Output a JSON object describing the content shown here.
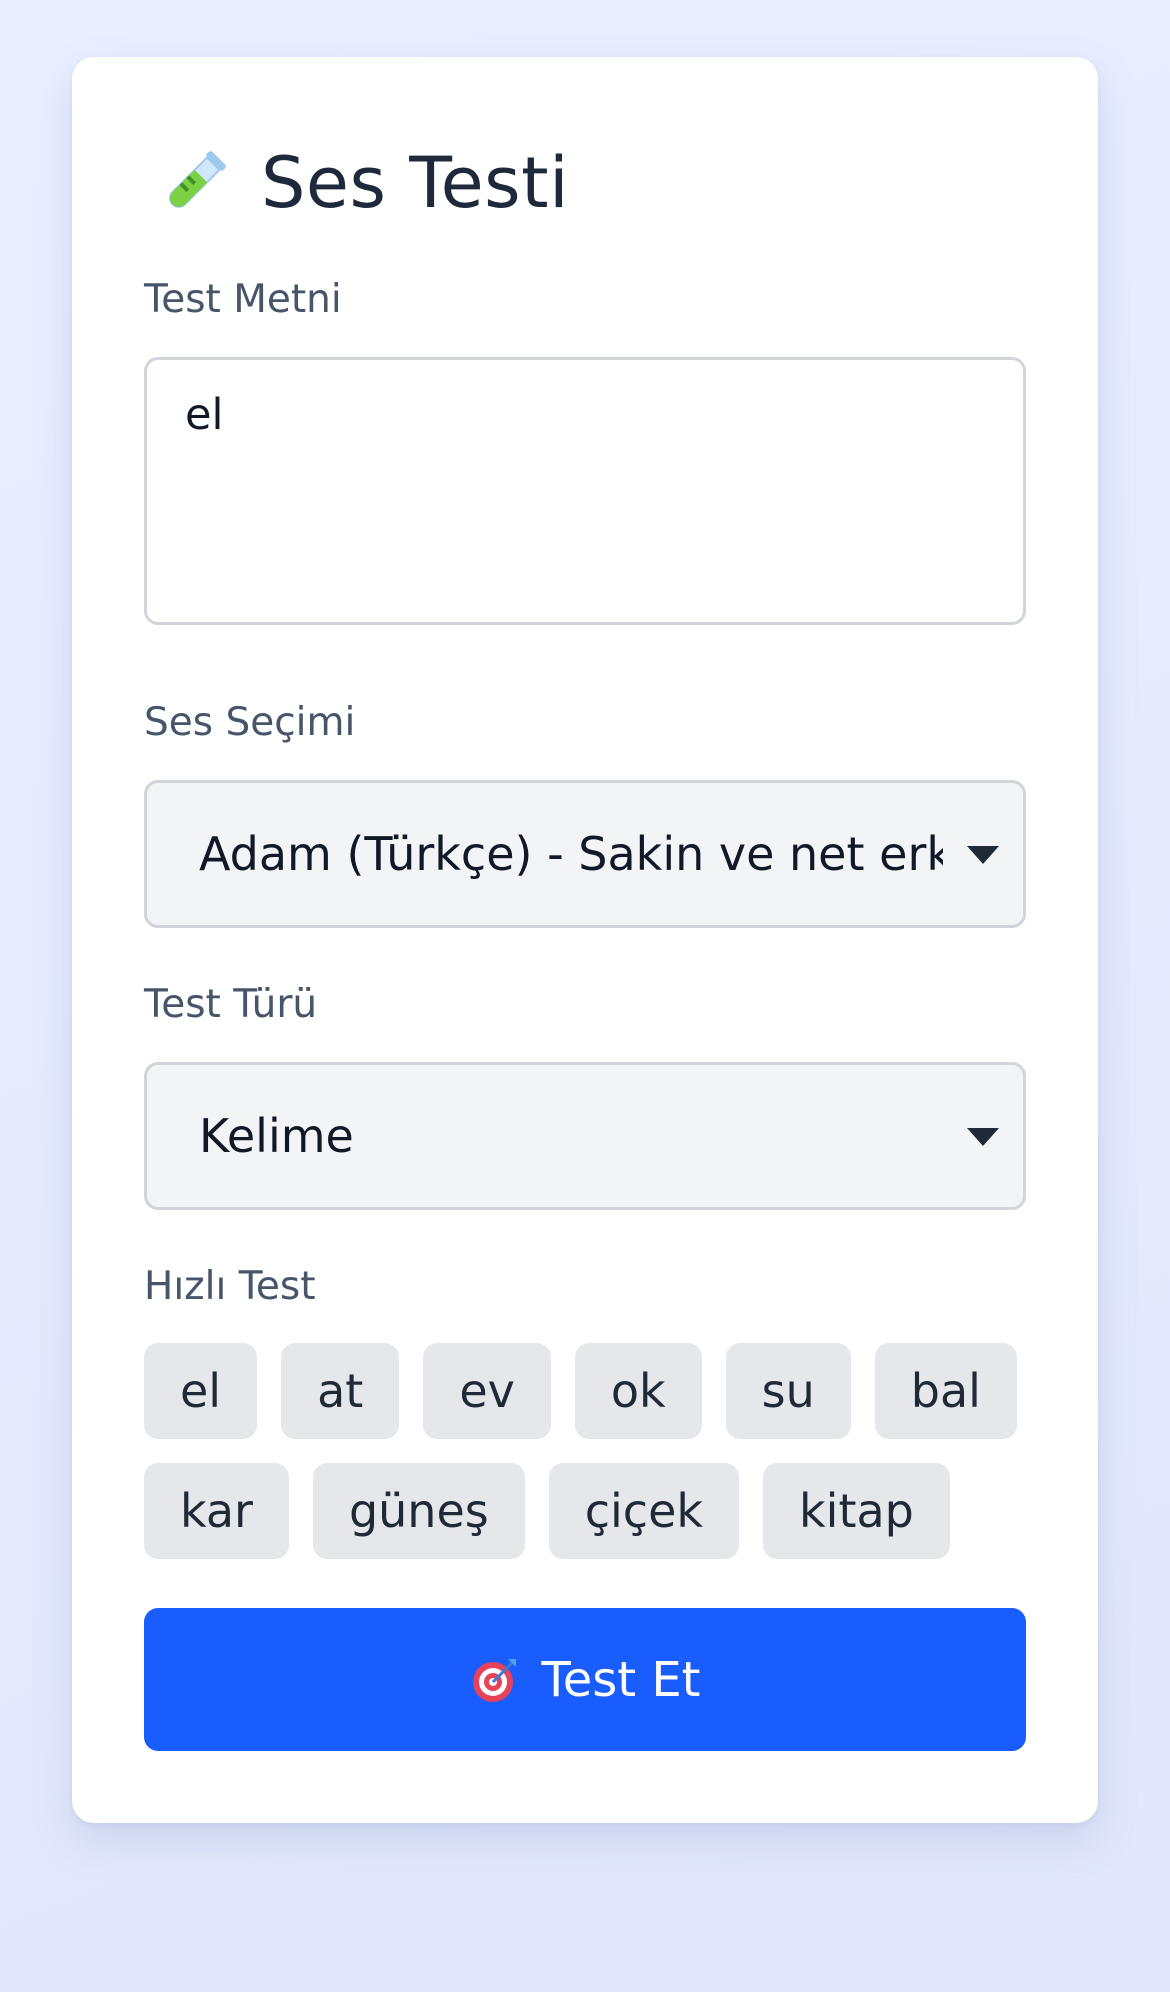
{
  "header": {
    "title": "Ses Testi",
    "icon": "test-tube-icon"
  },
  "form": {
    "text_label": "Test Metni",
    "text_value": "el",
    "voice_label": "Ses Seçimi",
    "voice_value": "Adam (Türkçe) - Sakin ve net erke",
    "type_label": "Test Türü",
    "type_value": "Kelime",
    "quick_label": "Hızlı Test"
  },
  "quick_words": {
    "row1": [
      "el",
      "at",
      "ev",
      "ok",
      "su",
      "bal"
    ],
    "row2": [
      "kar",
      "güneş",
      "çiçek",
      "kitap"
    ]
  },
  "action": {
    "label": "Test Et",
    "icon": "target-icon",
    "color": "#1a5dff"
  },
  "colors": {
    "background": "#e5ebfd",
    "card": "#ffffff",
    "chip": "#e5e7eb",
    "select": "#f3f4f6"
  }
}
